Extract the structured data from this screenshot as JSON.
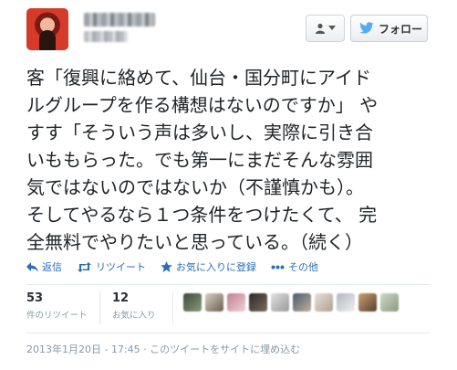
{
  "header": {
    "follow_label": "フォロー",
    "user_menu_icon": "person-icon",
    "follow_icon": "twitter-bird-icon"
  },
  "tweet": {
    "lines": [
      "客「復興に絡めて、仙台・国分町にアイド",
      "ルグループを作る構想はないのですか」 や",
      "すす「そういう声は多いし、実際に引き合",
      "いももらった。でも第一にまだそんな雰囲",
      "気ではないのではないか（不謹慎かも）。",
      "そしてやるなら１つ条件をつけたくて、 完",
      "全無料でやりたいと思っている。（続く）"
    ]
  },
  "actions": {
    "reply": "返信",
    "retweet": "リツイート",
    "favorite": "お気に入りに登録",
    "more": "その他"
  },
  "stats": {
    "retweets_count": "53",
    "retweets_label": "件のリツイート",
    "favorites_count": "12",
    "favorites_label": "お気に入り"
  },
  "footer": {
    "timestamp": "2013年1月20日 - 17:45 · このツイートをサイトに埋め込む"
  },
  "colors": {
    "link": "#2a6eb8",
    "muted": "#8899a6",
    "twitter_blue": "#55acee"
  }
}
